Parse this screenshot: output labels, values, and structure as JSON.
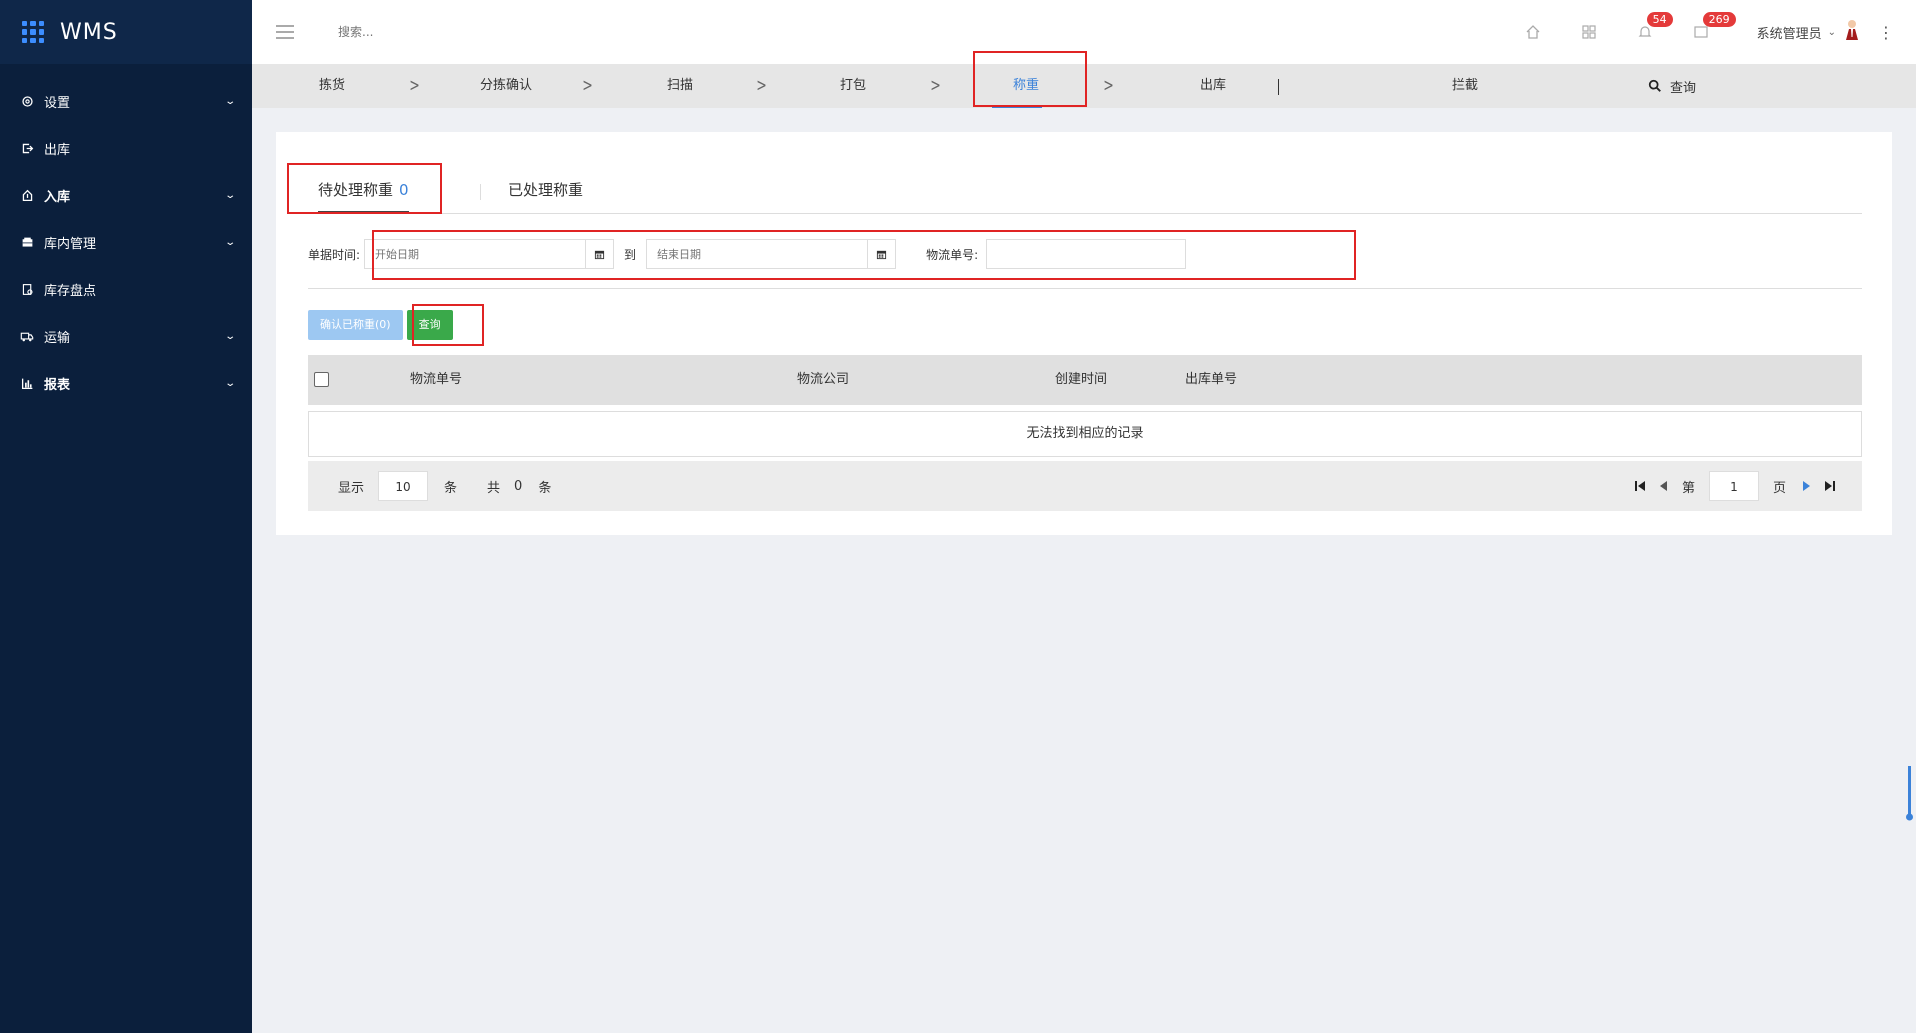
{
  "app": {
    "title": "WMS"
  },
  "sidebar": {
    "items": [
      {
        "label": "设置",
        "icon": "gear-icon",
        "expandable": true
      },
      {
        "label": "出库",
        "icon": "exit-icon",
        "expandable": false
      },
      {
        "label": "入库",
        "icon": "import-icon",
        "expandable": true
      },
      {
        "label": "库内管理",
        "icon": "inventory-icon",
        "expandable": true
      },
      {
        "label": "库存盘点",
        "icon": "stocktake-icon",
        "expandable": false
      },
      {
        "label": "运输",
        "icon": "truck-icon",
        "expandable": true
      },
      {
        "label": "报表",
        "icon": "chart-icon",
        "expandable": true
      }
    ]
  },
  "topbar": {
    "search_placeholder": "搜索...",
    "notifications_count": "54",
    "messages_count": "269",
    "user_name": "系统管理员"
  },
  "steps": {
    "picking": "拣货",
    "sort_confirm": "分拣确认",
    "scan": "扫描",
    "pack": "打包",
    "weigh": "称重",
    "ship": "出库",
    "intercept": "拦截",
    "query": "查询"
  },
  "tabs": {
    "pending_label": "待处理称重",
    "pending_count": "0",
    "done_label": "已处理称重"
  },
  "filter": {
    "date_label": "单据时间:",
    "start_placeholder": "开始日期",
    "to_label": "到",
    "end_placeholder": "结束日期",
    "tracking_label": "物流单号:",
    "tracking_value": ""
  },
  "actions": {
    "confirm_label": "确认已称重(0)",
    "query_label": "查询"
  },
  "table": {
    "columns": [
      "物流单号",
      "物流公司",
      "创建时间",
      "出库单号"
    ],
    "empty_text": "无法找到相应的记录"
  },
  "pager": {
    "show_label": "显示",
    "page_size": "10",
    "unit_label": "条",
    "total_label": "共",
    "total": "0",
    "total_unit": "条",
    "page_prefix": "第",
    "current_page": "1",
    "page_suffix": "页"
  }
}
